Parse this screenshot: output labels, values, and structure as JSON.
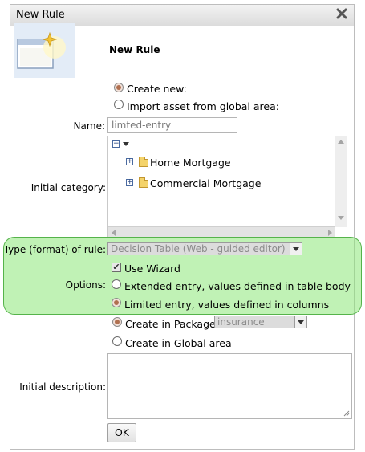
{
  "dialog": {
    "title": "New Rule",
    "header": "New Rule"
  },
  "source": {
    "create_new_label": "Create new:",
    "import_label": "Import asset from global area:",
    "create_new_selected": true
  },
  "name": {
    "label": "Name:",
    "value": "limted-entry"
  },
  "category": {
    "label": "Initial category:",
    "items": [
      "Home Mortgage",
      "Commercial Mortgage"
    ]
  },
  "rule_type": {
    "label": "Type (format) of rule:",
    "selected": "Decision Table (Web - guided editor)"
  },
  "options": {
    "label": "Options:",
    "use_wizard_label": "Use Wizard",
    "use_wizard_checked": true,
    "extended_label": "Extended entry, values defined in table body",
    "limited_label": "Limited entry, values defined in columns",
    "selected": "limited"
  },
  "package": {
    "create_in_package_label": "Create in Package:",
    "package_value": "insurance",
    "create_global_label": "Create in Global area",
    "selected": "package"
  },
  "description": {
    "label": "Initial description:"
  },
  "actions": {
    "ok_label": "OK"
  },
  "colors": {
    "highlight": "#8ce878",
    "highlight_border": "#55b34a"
  }
}
